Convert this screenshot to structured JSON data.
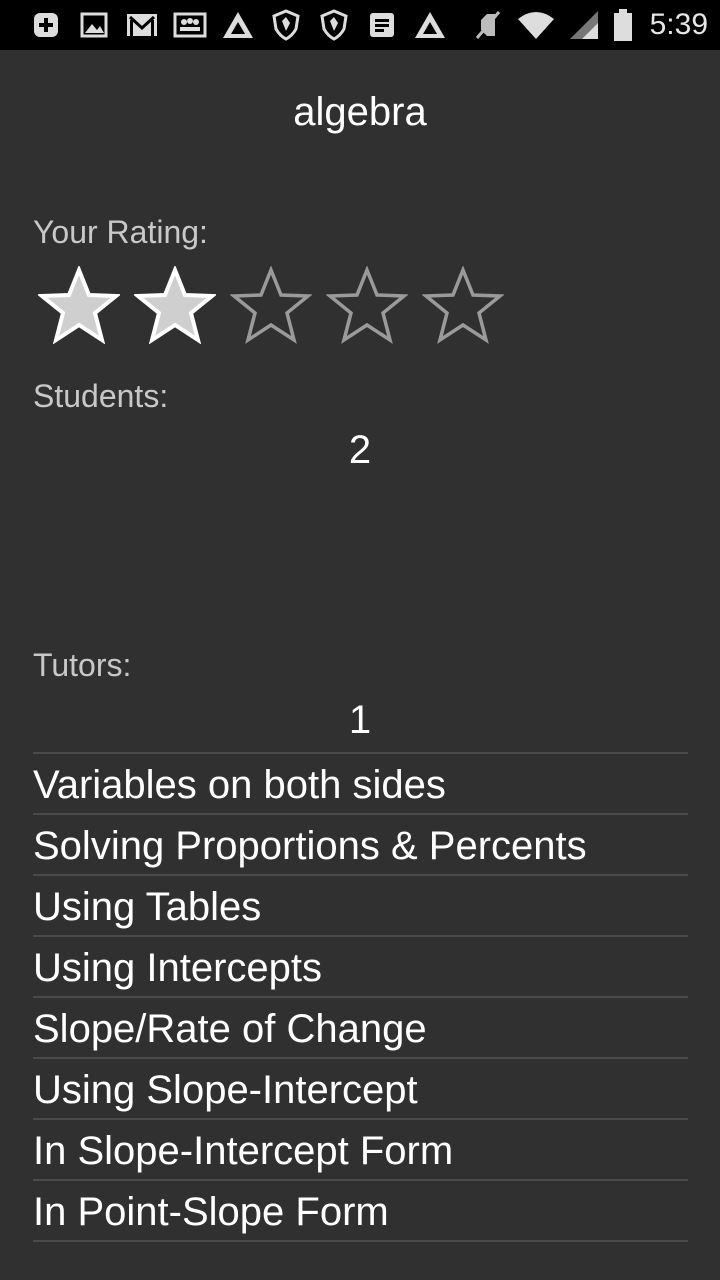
{
  "status_bar": {
    "left_icons": [
      "plus-icon",
      "image-icon",
      "gmail-icon",
      "group-icon",
      "triangle-app-icon",
      "shield-icon",
      "shield-icon",
      "notes-icon",
      "triangle-app-icon"
    ],
    "right_icons": [
      "mute-icon",
      "wifi-icon",
      "signal-icon",
      "battery-icon"
    ],
    "time": "5:39"
  },
  "subject": {
    "title": "algebra"
  },
  "rating": {
    "label": "Your Rating:",
    "value": 2,
    "max": 5
  },
  "students": {
    "label": "Students:",
    "count": "2"
  },
  "tutors": {
    "label": "Tutors:",
    "count": "1"
  },
  "topics": [
    "Variables on both sides",
    "Solving Proportions & Percents",
    "Using Tables",
    "Using Intercepts",
    "Slope/Rate of Change",
    "Using Slope-Intercept",
    "In Slope-Intercept Form",
    "In Point-Slope Form"
  ],
  "colors": {
    "background": "#303030",
    "status_bar": "#000000",
    "label": "#c8c8c8",
    "star_filled": "#cfcfcf",
    "star_outline": "#9a9a9a",
    "divider": "#4a4a4a"
  }
}
